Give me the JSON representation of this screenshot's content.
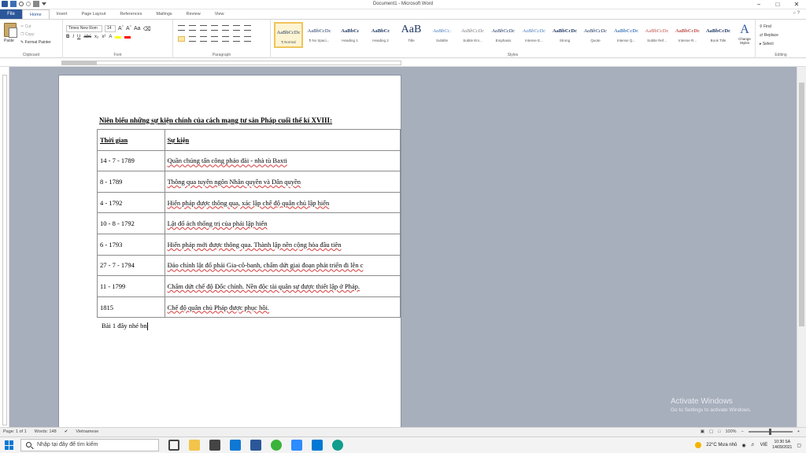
{
  "window": {
    "title": "Document1 - Microsoft Word",
    "controls": [
      "−",
      "□",
      "✕"
    ]
  },
  "tabs": [
    "File",
    "Home",
    "Insert",
    "Page Layout",
    "References",
    "Mailings",
    "Review",
    "View"
  ],
  "ribbon": {
    "clipboard": {
      "paste": "Paste",
      "cut": "Cut",
      "copy": "Copy",
      "format_painter": "Format Painter",
      "label": "Clipboard"
    },
    "font": {
      "name": "Times New Rom",
      "size": "14",
      "label": "Font"
    },
    "paragraph": {
      "label": "Paragraph"
    },
    "styles": {
      "label": "Styles",
      "items": [
        {
          "preview": "AaBbCcDc",
          "name": "¶ Normal"
        },
        {
          "preview": "AaBbCcDc",
          "name": "¶ No Spaci..."
        },
        {
          "preview": "AaBbCı",
          "name": "Heading 1"
        },
        {
          "preview": "AaBbCc",
          "name": "Heading 2"
        },
        {
          "preview": "AaB",
          "name": "Title"
        },
        {
          "preview": "AaBbCc.",
          "name": "Subtitle"
        },
        {
          "preview": "AaBbCcDc",
          "name": "Subtle Em..."
        },
        {
          "preview": "AaBbCcDc",
          "name": "Emphasis"
        },
        {
          "preview": "AaBbCcDc",
          "name": "Intense E..."
        },
        {
          "preview": "AaBbCcDc",
          "name": "Strong"
        },
        {
          "preview": "AaBbCcDc",
          "name": "Quote"
        },
        {
          "preview": "AaBbCcDc",
          "name": "Intense Q..."
        },
        {
          "preview": "AaBbCcDc",
          "name": "Subtle Ref..."
        },
        {
          "preview": "AaBbCcDc",
          "name": "Intense R..."
        },
        {
          "preview": "AaBbCcDc",
          "name": "Book Title"
        }
      ],
      "change_styles": "Change Styles"
    },
    "editing": {
      "find": "Find",
      "replace": "Replace",
      "select": "Select",
      "label": "Editing"
    }
  },
  "document": {
    "heading": "Niên biểu những sự kiện chính của cách mạng tư sản Pháp cuối thế kí XVIII:",
    "columns": [
      "Thời gian",
      "Sự kiện"
    ],
    "rows": [
      {
        "time": "14 - 7 - 1789",
        "event": "Quần chúng tấn công pháo đài - nhà tù Baxti"
      },
      {
        "time": "8 - 1789",
        "event": "Thông qua tuyên ngôn Nhân quyền và Dân quyền"
      },
      {
        "time": "4 - 1792",
        "event": "Hiến pháp được thông qua, xác lập chế độ quân chủ lập hiến"
      },
      {
        "time": "10 - 8 - 1792",
        "event": "Lật đổ ách thống trị của phái lập hiến"
      },
      {
        "time": "6 - 1793",
        "event": "Hiến pháp mới được thông qua. Thành lập nền cộng hòa đầu tiên"
      },
      {
        "time": "27 - 7 - 1794",
        "event": "Đảo chính lật đổ phái Gia-cô-banh, chấm dứt giai đoạn phát triển đi lên c"
      },
      {
        "time": "11 - 1799",
        "event": "Chấm dứt chế độ Đốc chính. Nền độc tài quân sự được thiết lập ở Pháp."
      },
      {
        "time": "1815",
        "event": "Chế độ quân chủ Pháp được phục hồi."
      }
    ],
    "body_text": "Bài 1 đây nhé bn"
  },
  "watermark": {
    "line1": "Activate Windows",
    "line2": "Go to Settings to activate Windows."
  },
  "statusbar": {
    "page": "Page: 1 of 1",
    "words": "Words: 148",
    "language": "Vietnamese",
    "zoom": "100%"
  },
  "taskbar": {
    "search_placeholder": "Nhập tại đây để tìm kiếm",
    "weather": "22°C Mưa nhỏ",
    "lang": "VIE",
    "time": "10:30 SA",
    "date": "14/09/2021"
  },
  "colors": {
    "accent": "#2b579a",
    "doc_bg": "#a7afbd"
  }
}
